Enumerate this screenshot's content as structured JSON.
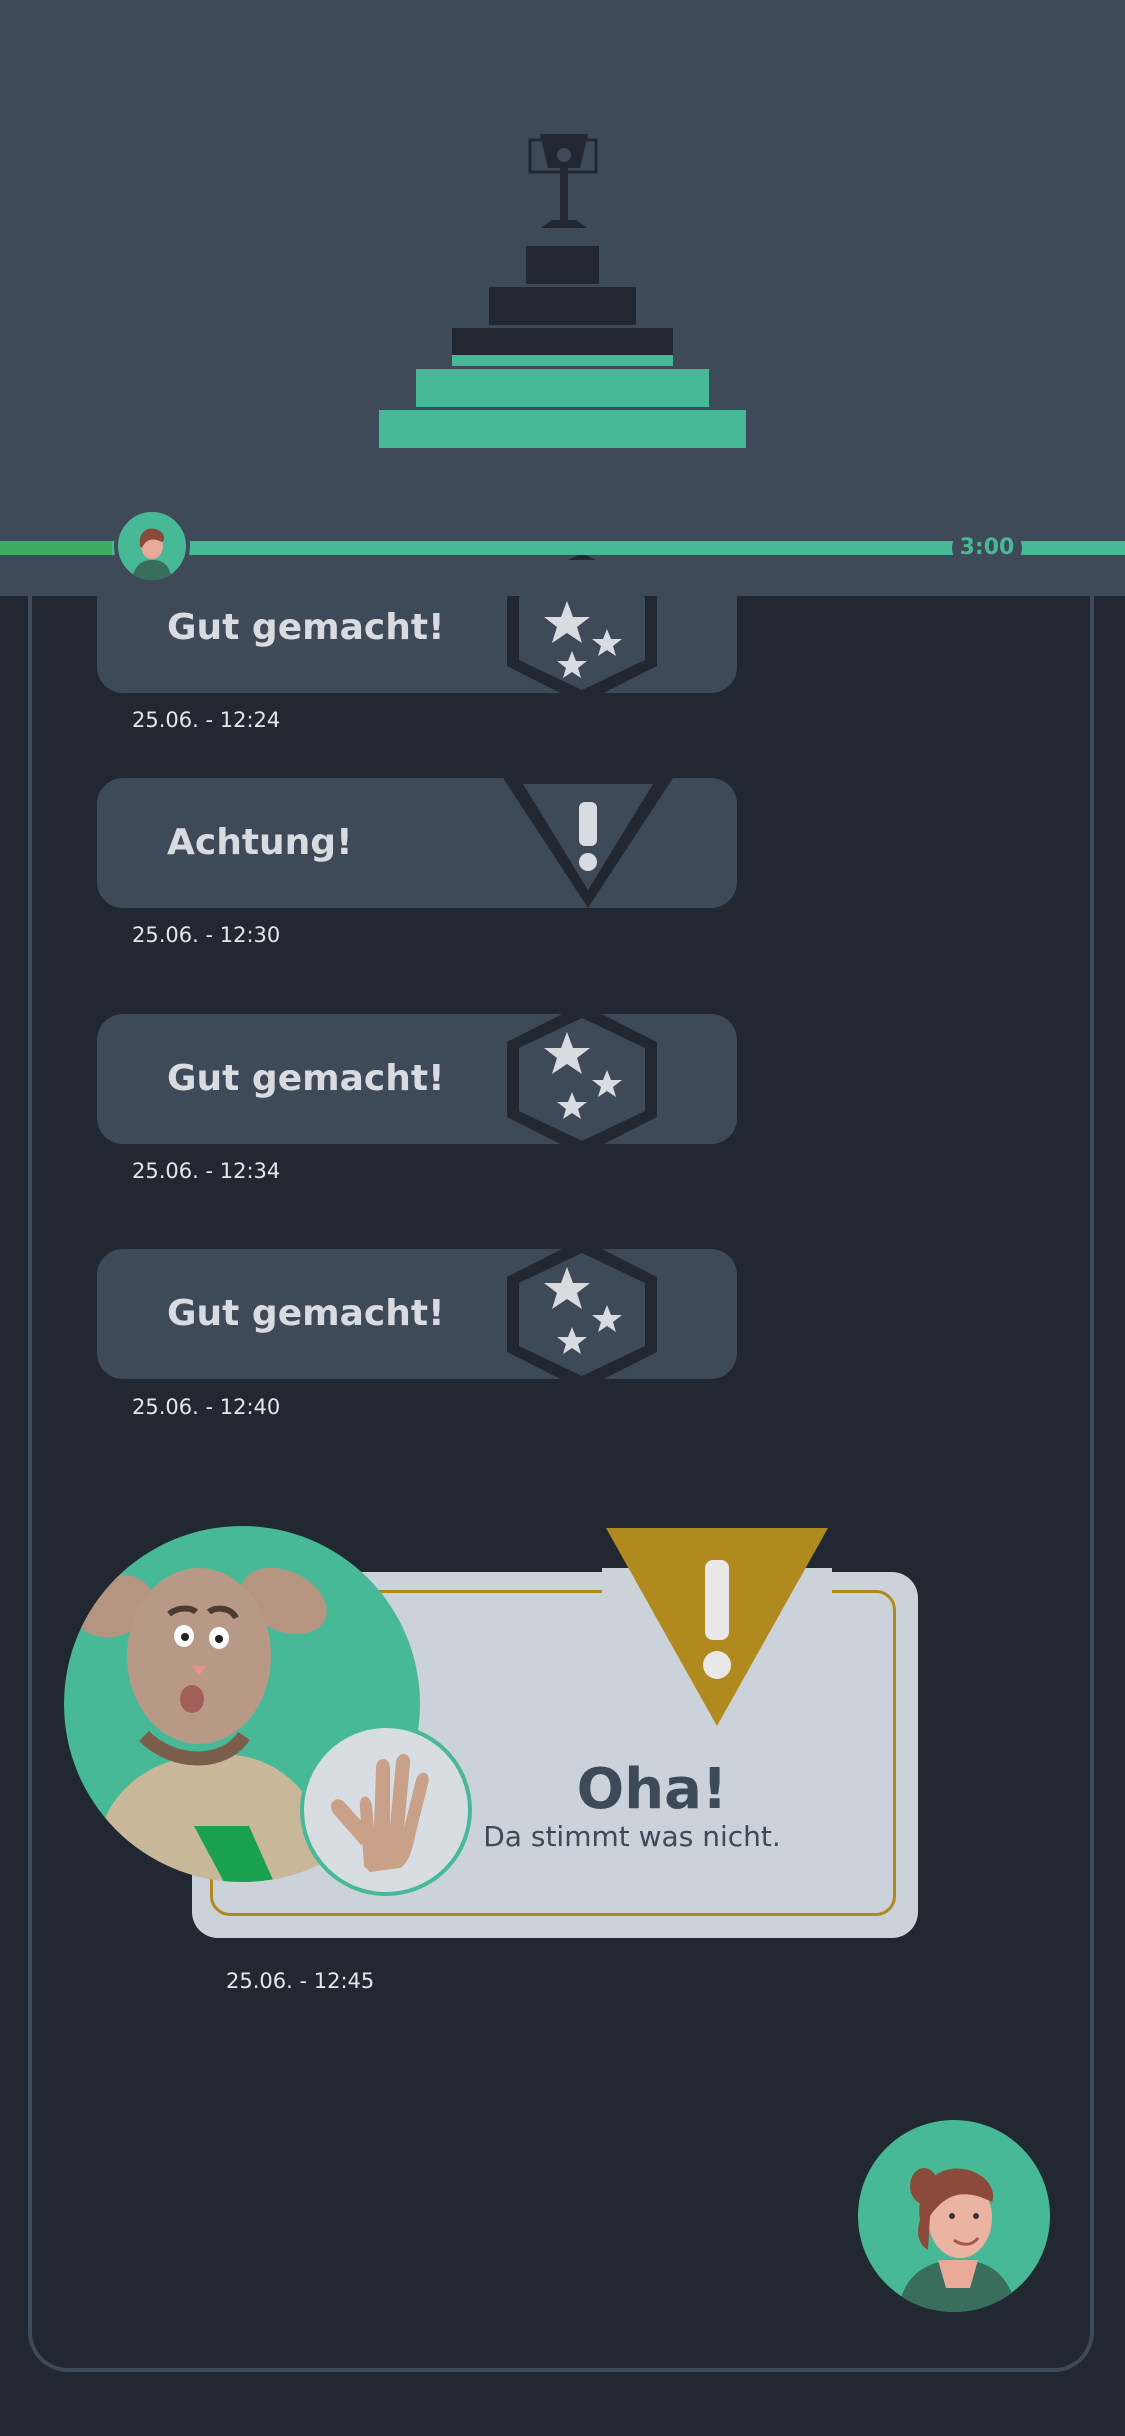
{
  "colors": {
    "background": "#222831",
    "header": "#3e4a57",
    "accent": "#48b997",
    "progress_fill": "#3cab63",
    "card": "#3e4a57",
    "warning": "#b08a1e",
    "popup": "#cbd2d9"
  },
  "header": {
    "icon": "trophy-podium-icon",
    "timer": "3:00",
    "progress": 0.1
  },
  "messages": [
    {
      "label": "Gut gemacht!",
      "time": "25.06. - 12:24",
      "badge": "stars-hexagon-icon"
    },
    {
      "label": "Achtung!",
      "time": "25.06. - 12:30",
      "badge": "exclamation-triangle-icon"
    },
    {
      "label": "Gut gemacht!",
      "time": "25.06. - 12:34",
      "badge": "stars-hexagon-icon"
    },
    {
      "label": "Gut gemacht!",
      "time": "25.06. - 12:40",
      "badge": "stars-hexagon-icon"
    }
  ],
  "popup": {
    "title": "Oha!",
    "subtitle": "Da stimmt was nicht.",
    "time": "25.06. - 12:45",
    "character": "rabbit-character",
    "gesture": "stop-hand-icon"
  },
  "user_avatar": "user-avatar"
}
